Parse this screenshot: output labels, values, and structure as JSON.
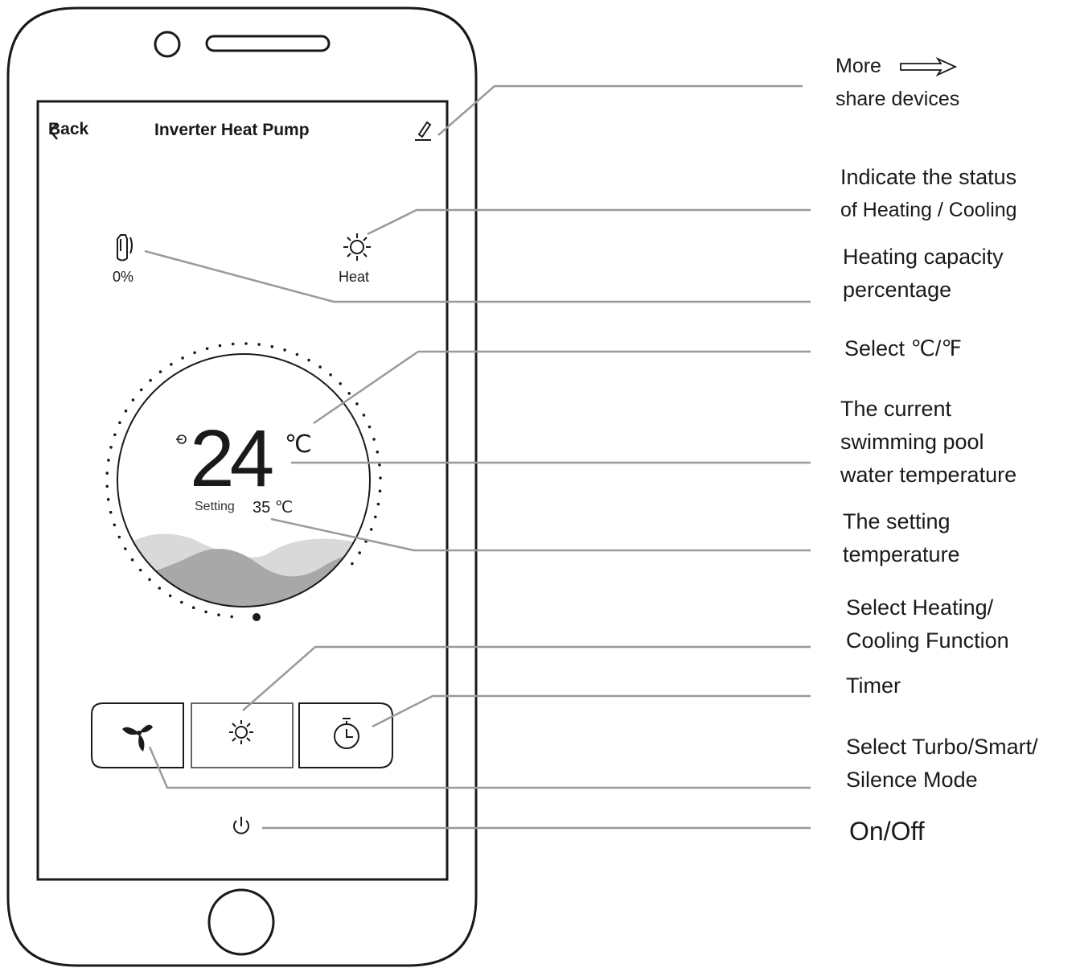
{
  "app": {
    "back_label": "Back",
    "title": "Inverter Heat Pump",
    "capacity_value": "0%",
    "mode_label": "Heat",
    "current_temp": "24",
    "temp_unit": "℃",
    "setting_label": "Setting",
    "setting_value": "35 ℃",
    "icons": [
      "back-chevron-icon",
      "edit-pencil-icon",
      "capacity-icon",
      "sun-icon",
      "fan-icon",
      "timer-icon",
      "power-icon",
      "input-icon"
    ]
  },
  "annotations": {
    "more": {
      "line1": "More",
      "line2": "share devices"
    },
    "status": {
      "line1": "Indicate the status",
      "line2": "of Heating / Cooling"
    },
    "capacity": {
      "line1": "Heating capacity",
      "line2": "percentage"
    },
    "unit": {
      "line1": "Select ℃/℉"
    },
    "current": {
      "line1": "The current",
      "line2": "swimming pool",
      "line3": "water temperature"
    },
    "setting": {
      "line1": "The setting",
      "line2": "temperature"
    },
    "function": {
      "line1": "Select Heating/",
      "line2": "Cooling Function"
    },
    "timer": {
      "line1": "Timer"
    },
    "turbo": {
      "line1": "Select Turbo/Smart/",
      "line2": "Silence Mode"
    },
    "onoff": {
      "line1": "On/Off"
    }
  },
  "colors": {
    "outline": "#1a1a1a",
    "leader": "#9a9a9a",
    "wave_light": "#d9d9d9",
    "wave_dark": "#a8a8a8"
  }
}
